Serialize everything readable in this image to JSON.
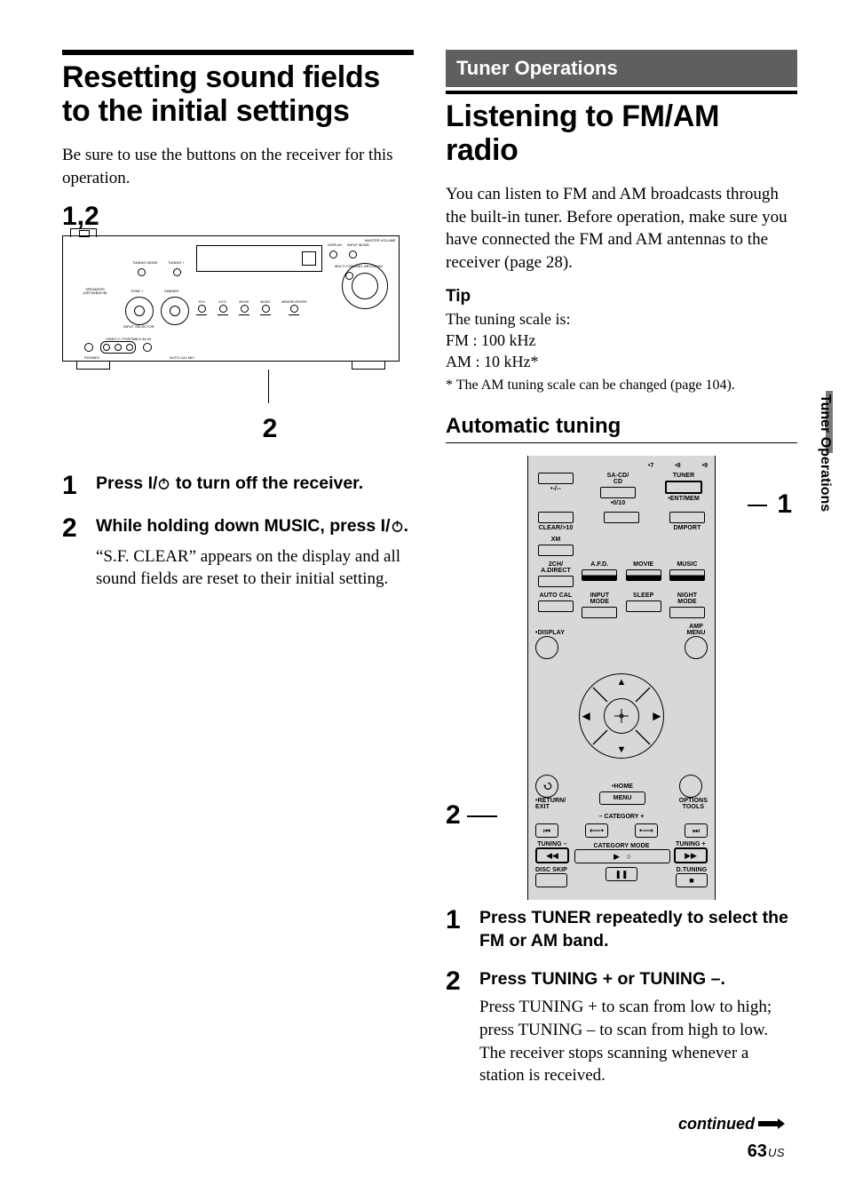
{
  "left": {
    "heading": "Resetting sound fields to the initial settings",
    "intro": "Be sure to use the buttons on the receiver for this operation.",
    "callout_top": "1,2",
    "receiver_labels": {
      "input_selector": "INPUT SELECTOR",
      "tuning_mode": "TUNING MODE",
      "display": "DISPLAY",
      "input_mode": "INPUT MODE",
      "master_volume": "MASTER VOLUME",
      "speakers": "SPEAKERS (OFF/A/B/A+B)",
      "tone": "TONE +",
      "tuning": "TUNING +",
      "phones": "PHONES",
      "multi": "MULTI CHANNEL DECODING",
      "two_ch": "2CH",
      "afd": "A.F.D.",
      "movie": "MOVIE",
      "music": "MUSIC",
      "dimmer": "DIMMER",
      "memory": "MEMORY/ENTER",
      "video": "VIDEO 2 / PORTABLE AV IN",
      "auto_cal": "AUTO CAL MIC"
    },
    "callout_bottom": "2",
    "steps": [
      {
        "n": "1",
        "lead_a": "Press ",
        "lead_b": " to turn off the receiver.",
        "power_prefix": "I/"
      },
      {
        "n": "2",
        "lead_a": "While holding down MUSIC, press ",
        "lead_b": ".",
        "power_prefix": "I/",
        "rest": "“S.F. CLEAR” appears on the display and all sound fields are reset to their initial setting."
      }
    ]
  },
  "right": {
    "chapter": "Tuner Operations",
    "heading": "Listening to FM/AM radio",
    "intro": "You can listen to FM and AM broadcasts through the built-in tuner. Before operation, make sure you have connected the FM and AM antennas to the receiver (page 28).",
    "tip_head": "Tip",
    "tip_lines": [
      "The tuning scale is:",
      "FM : 100 kHz",
      "AM : 10 kHz*"
    ],
    "tip_footnote": "* The AM tuning scale can be changed (page 104).",
    "subhead": "Automatic tuning",
    "remote": {
      "callout1": "1",
      "callout2": "2",
      "top_dots": [
        "7",
        "8",
        "9"
      ],
      "row2": [
        "-/--",
        "0/10"
      ],
      "sa_cd": "SA-CD/\nCD",
      "tuner": "TUNER",
      "ent_mem": "ENT/MEM",
      "dmport": "DMPORT",
      "clear": "CLEAR/>10",
      "xm": "XM",
      "two_ch": "2CH/\nA.DIRECT",
      "afd": "A.F.D.",
      "movie": "MOVIE",
      "music": "MUSIC",
      "auto_cal": "AUTO CAL",
      "input_mode": "INPUT\nMODE",
      "sleep": "SLEEP",
      "night": "NIGHT\nMODE",
      "display": "DISPLAY",
      "amp_menu": "AMP\nMENU",
      "return": "RETURN/\nEXIT",
      "home": "HOME",
      "menu": "MENU",
      "options": "OPTIONS\nTOOLS",
      "cat": "– CATEGORY +",
      "tuning_minus": "TUNING –",
      "cat_mode": "CATEGORY MODE",
      "tuning_plus": "TUNING +",
      "disc_skip": "DISC SKIP",
      "dtuning": "D.TUNING"
    },
    "steps": [
      {
        "n": "1",
        "lead": "Press TUNER repeatedly to select the FM or AM band."
      },
      {
        "n": "2",
        "lead": "Press TUNING + or TUNING –.",
        "rest": "Press TUNING + to scan from low to high; press TUNING – to scan from high to low.\nThe receiver stops scanning whenever a station is received."
      }
    ]
  },
  "footer": {
    "continued": "continued",
    "page_num": "63",
    "page_suffix": "US"
  },
  "side_tab": "Tuner Operations"
}
